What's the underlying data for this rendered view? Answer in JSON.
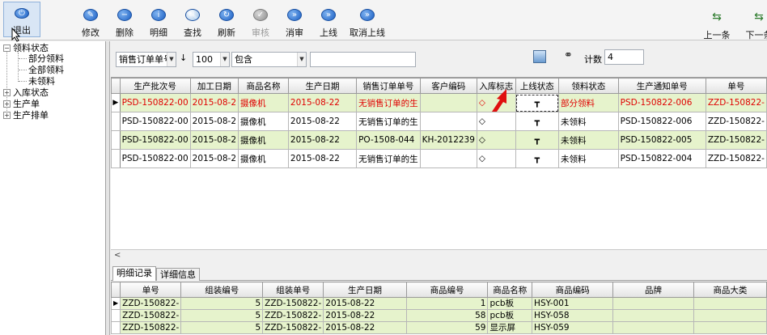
{
  "toolbar": {
    "exit": "退出",
    "edit": "修改",
    "delete": "删除",
    "detail": "明细",
    "find": "查找",
    "refresh": "刷新",
    "audit": "审核",
    "unaudit": "消审",
    "online": "上线",
    "cancel_online": "取消上线",
    "prev": "上一条",
    "next": "下一条"
  },
  "tree": {
    "root1": "领料状态",
    "root1_children": [
      "部分领料",
      "全部领料",
      "未领料"
    ],
    "root2": "入库状态",
    "root3": "生产单",
    "root4": "生产排单"
  },
  "filter": {
    "field": "销售订单单号",
    "sort_icon": "↓",
    "limit": "100",
    "operator": "包含",
    "value": "",
    "count_label": "计数",
    "count_value": "4"
  },
  "grid": {
    "headers": [
      "生产批次号",
      "加工日期",
      "商品名称",
      "生产日期",
      "销售订单单号",
      "客户编码",
      "入库标志",
      "上线状态",
      "领料状态",
      "生产通知单号",
      "单号"
    ],
    "rows": [
      [
        "PSD-150822-00",
        "2015-08-2",
        "摄像机",
        "2015-08-22",
        "无销售订单的生",
        "",
        "◇",
        "┳",
        "部分领料",
        "PSD-150822-006",
        "ZZD-150822-"
      ],
      [
        "PSD-150822-00",
        "2015-08-2",
        "摄像机",
        "2015-08-22",
        "无销售订单的生",
        "",
        "◇",
        "┳",
        "未领料",
        "PSD-150822-006",
        "ZZD-150822-"
      ],
      [
        "PSD-150822-00",
        "2015-08-2",
        "摄像机",
        "2015-08-22",
        "PO-1508-044",
        "KH-2012239",
        "◇",
        "┳",
        "未领料",
        "PSD-150822-005",
        "ZZD-150822-"
      ],
      [
        "PSD-150822-00",
        "2015-08-2",
        "摄像机",
        "2015-08-22",
        "无销售订单的生",
        "",
        "◇",
        "┳",
        "未领料",
        "PSD-150822-004",
        "ZZD-150822-"
      ]
    ]
  },
  "tabs": [
    "明细记录",
    "详细信息"
  ],
  "detail": {
    "headers": [
      "单号",
      "组装编号",
      "组装单号",
      "生产日期",
      "商品编号",
      "商品名称",
      "商品编码",
      "品牌",
      "商品大类"
    ],
    "rows": [
      [
        "ZZD-150822-",
        "5",
        "ZZD-150822-",
        "2015-08-22",
        "1",
        "pcb板",
        "HSY-001",
        "",
        ""
      ],
      [
        "ZZD-150822-",
        "5",
        "ZZD-150822-",
        "2015-08-22",
        "58",
        "pcb板",
        "HSY-058",
        "",
        ""
      ],
      [
        "ZZD-150822-",
        "5",
        "ZZD-150822-",
        "2015-08-22",
        "59",
        "显示屏",
        "HSY-059",
        "",
        ""
      ]
    ]
  },
  "colors": {
    "row_highlight": "#e6f3cc",
    "current_text": "#e00000",
    "toolbar_icon": "#1a5fc4"
  }
}
